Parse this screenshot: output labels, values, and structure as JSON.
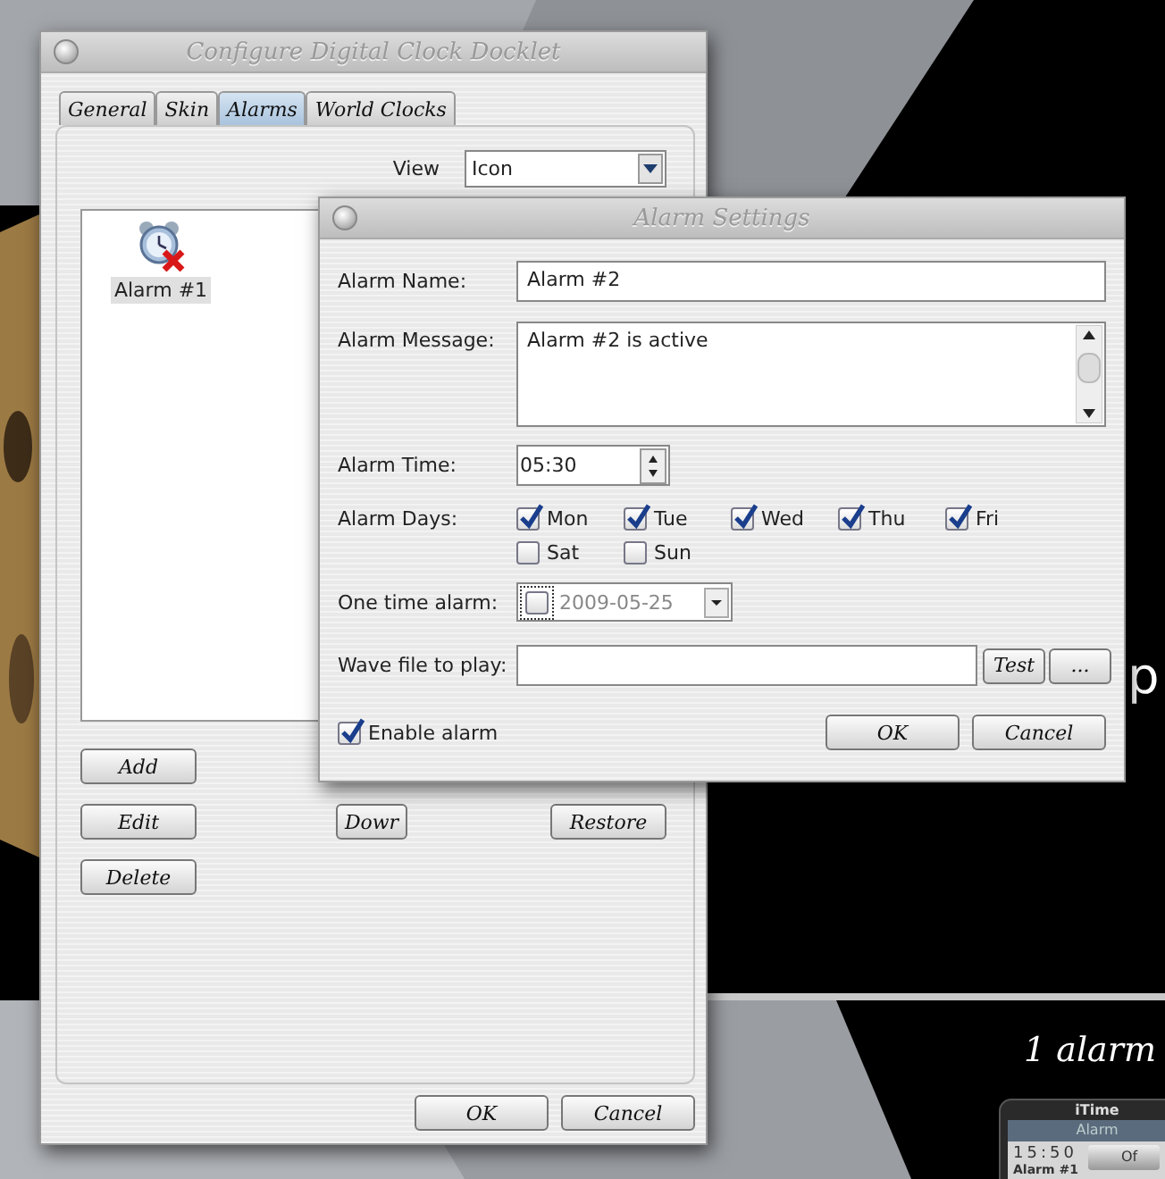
{
  "desktop": {
    "large_text": "p",
    "alarm_count_text": "1 alarm",
    "widget": {
      "title": "iTime",
      "header": "Alarm",
      "time": "15:50",
      "alarm_name": "Alarm #1",
      "toggle": "Of"
    }
  },
  "main_window": {
    "title": "Configure Digital Clock Docklet",
    "tabs": [
      {
        "label": "General",
        "selected": false
      },
      {
        "label": "Skin",
        "selected": false
      },
      {
        "label": "Alarms",
        "selected": true
      },
      {
        "label": "World Clocks",
        "selected": false
      }
    ],
    "view": {
      "label": "View",
      "value": "Icon"
    },
    "alarms": [
      {
        "name": "Alarm #1",
        "selected": true
      }
    ],
    "list_buttons": [
      "Add",
      "Edit",
      "Delete"
    ],
    "move_button": "Dowr",
    "restore_button": "Restore",
    "buttons": [
      "OK",
      "Cancel"
    ]
  },
  "dialog": {
    "title": "Alarm Settings",
    "name": {
      "label": "Alarm Name:",
      "value": "Alarm #2"
    },
    "message": {
      "label": "Alarm Message:",
      "value": "Alarm #2 is active"
    },
    "time": {
      "label": "Alarm Time:",
      "value": "05:30"
    },
    "days_label": "Alarm Days:",
    "days": [
      {
        "label": "Mon",
        "checked": true
      },
      {
        "label": "Tue",
        "checked": true
      },
      {
        "label": "Wed",
        "checked": true
      },
      {
        "label": "Thu",
        "checked": true
      },
      {
        "label": "Fri",
        "checked": true
      },
      {
        "label": "Sat",
        "checked": false
      },
      {
        "label": "Sun",
        "checked": false
      }
    ],
    "one_time": {
      "label": "One time alarm:",
      "checked": false,
      "date": "2009-05-25"
    },
    "wave": {
      "label": "Wave file to play:",
      "test_button": "Test",
      "browse_button": "..."
    },
    "enable": {
      "label": "Enable alarm",
      "checked": true
    },
    "buttons": [
      "OK",
      "Cancel"
    ]
  }
}
